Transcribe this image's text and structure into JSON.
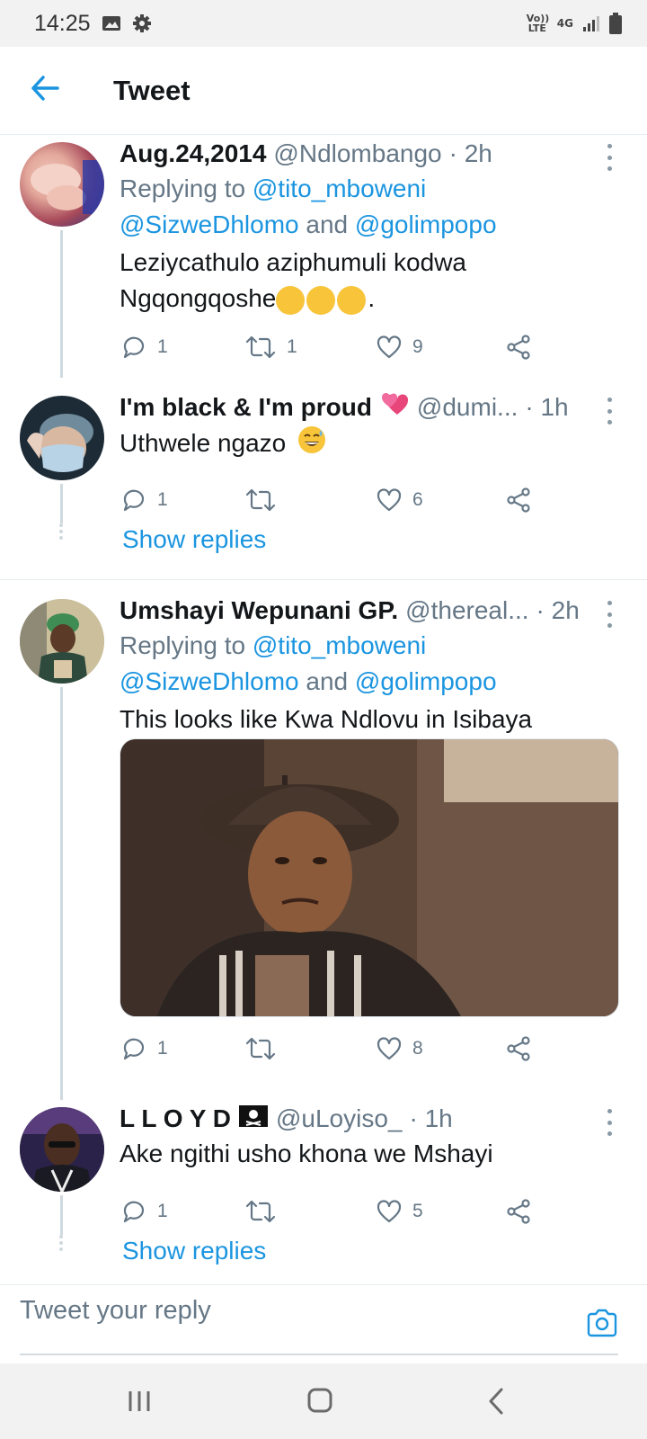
{
  "status_bar": {
    "time": "14:25",
    "icons": [
      "image-icon",
      "settings-icon"
    ],
    "network_label_1": "Vo)) LTE",
    "network_label_2": "4G"
  },
  "header": {
    "title": "Tweet",
    "back_icon": "back-arrow-icon"
  },
  "tweets": [
    {
      "name": "Aug.24,2014",
      "handle": "@Ndlombango",
      "time": "· 2h",
      "replying_prefix": "Replying to ",
      "replying_to_1": "@tito_mboweni",
      "replying_to_2": "@SizweDhlomo",
      "replying_and": " and ",
      "replying_to_3": "@golimpopo",
      "text_line1": "Leziycathulo aziphumuli kodwa",
      "text_line2": "Ngqongqoshe",
      "text_suffix": ".",
      "reply_count": "1",
      "retweet_count": "1",
      "like_count": "9"
    },
    {
      "name": "I'm black & I'm proud",
      "handle": "@dumi...",
      "time": "· 1h",
      "text": "Uthwele ngazo",
      "reply_count": "1",
      "retweet_count": "",
      "like_count": "6",
      "show_replies": "Show replies"
    },
    {
      "name": "Umshayi Wepunani GP.",
      "handle": "@thereal...",
      "time": "· 2h",
      "replying_prefix": "Replying to ",
      "replying_to_1": "@tito_mboweni",
      "replying_to_2": "@SizweDhlomo",
      "replying_and": " and ",
      "replying_to_3": "@golimpopo",
      "text": "This looks like Kwa Ndlovu in Isibaya",
      "reply_count": "1",
      "retweet_count": "",
      "like_count": "8"
    },
    {
      "name": "L L O Y D",
      "handle": "@uLoyiso_",
      "time": "· 1h",
      "text": "Ake ngithi usho khona we Mshayi",
      "reply_count": "1",
      "retweet_count": "",
      "like_count": "5",
      "show_replies": "Show replies"
    }
  ],
  "composer": {
    "placeholder": "Tweet your reply"
  },
  "colors": {
    "accent": "#1b95e0",
    "muted": "#657786",
    "text": "#14171a",
    "divider": "#e6ecf0"
  }
}
